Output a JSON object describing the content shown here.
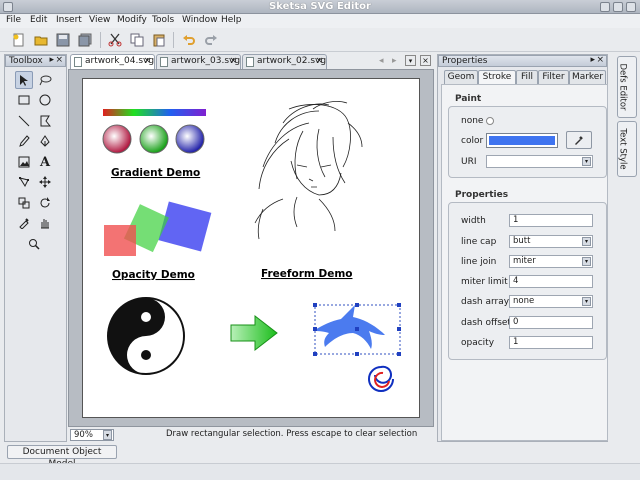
{
  "window": {
    "title": "Sketsa SVG Editor"
  },
  "menu": [
    "File",
    "Edit",
    "Insert",
    "View",
    "Modify",
    "Tools",
    "Window",
    "Help"
  ],
  "toolbox": {
    "title": "Toolbox"
  },
  "tabs": [
    {
      "label": "artwork_04.svg",
      "active": true
    },
    {
      "label": "artwork_03.svg",
      "active": false
    },
    {
      "label": "artwork_02.svg",
      "active": false
    }
  ],
  "canvas": {
    "gradient_label": "Gradient Demo",
    "opacity_label": "Opacity Demo",
    "freeform_label": "Freeform Demo",
    "colors": {
      "arrow": "#3fd13f",
      "dolphin": "#4b7bef",
      "blue_rect": "#3a3ff0",
      "red_rect": "#f05050",
      "green_rect": "#3ad03a"
    }
  },
  "status": {
    "zoom": "90%",
    "message": "Draw rectangular selection. Press escape to clear selection"
  },
  "properties": {
    "title": "Properties",
    "tabs": [
      "Geom",
      "Stroke",
      "Fill",
      "Filter",
      "Marker"
    ],
    "active_tab": "Stroke",
    "paint": {
      "group_label": "Paint",
      "none_label": "none",
      "color_label": "color",
      "color_value": "#3f74f0",
      "uri_label": "URI"
    },
    "stroke": {
      "group_label": "Properties",
      "width_label": "width",
      "width_value": "1",
      "linecap_label": "line cap",
      "linecap_value": "butt",
      "linejoin_label": "line join",
      "linejoin_value": "miter",
      "miterlimit_label": "miter limit",
      "miterlimit_value": "4",
      "dasharray_label": "dash array",
      "dasharray_value": "none",
      "dashoffset_label": "dash offset",
      "dashoffset_value": "0",
      "opacity_label": "opacity",
      "opacity_value": "1"
    }
  },
  "side_tabs": [
    "Defs Editor",
    "Text Style"
  ],
  "bottom": {
    "dom_tab": "Document Object Model"
  }
}
